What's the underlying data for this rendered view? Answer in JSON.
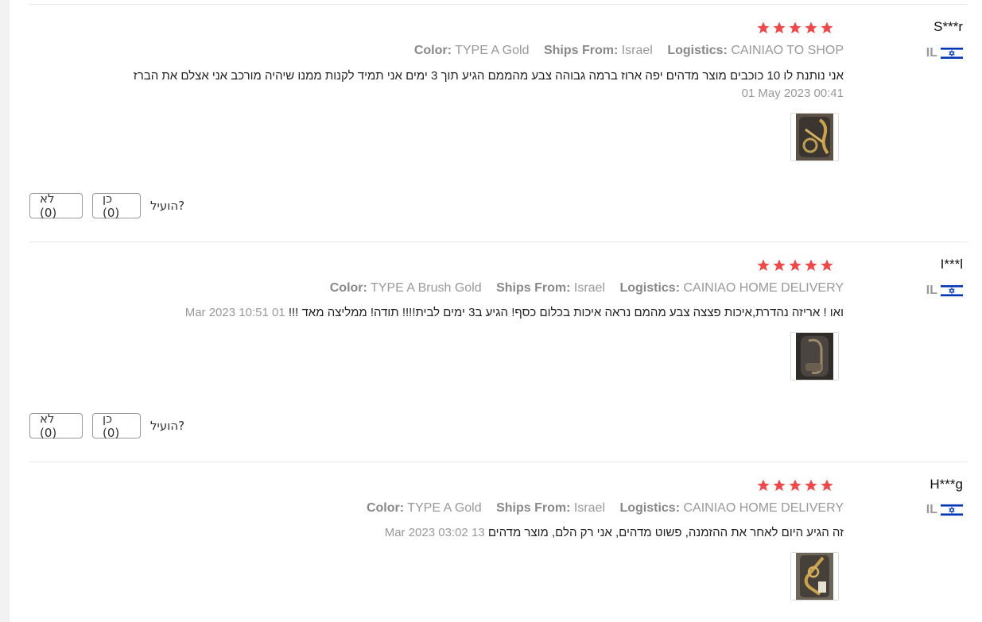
{
  "reviews": [
    {
      "user": "S***r",
      "country": "IL",
      "stars": 5,
      "color_label": "Color:",
      "color_value": "TYPE A Gold",
      "ships_label": "Ships From:",
      "ships_value": "Israel",
      "logistics_label": "Logistics:",
      "logistics_value": "CAINIAO TO SHOP",
      "text": "אני נותנת לו 10 כוכבים מוצר מדהים יפה ארוז ברמה גבוהה צבע מהממם הגיע תוך 3 ימים אני תמיד לקנות ממנו שיהיה מורכב אני אצלם את הברז",
      "date": "01 May 2023 00:41",
      "helpful_label": "הועיל?",
      "yes_label": "כן (0)",
      "no_label": "לא (0)"
    },
    {
      "user": "I***l",
      "country": "IL",
      "stars": 5,
      "color_label": "Color:",
      "color_value": "TYPE A Brush Gold",
      "ships_label": "Ships From:",
      "ships_value": "Israel",
      "logistics_label": "Logistics:",
      "logistics_value": "CAINIAO HOME DELIVERY",
      "text": "ואו ! אריזה נהדרת,איכות פצצה צבע מהמם נראה איכות בכלום כסף! הגיע ב3 ימים לבית!!!! תודה! ממליצה מאד !!!",
      "date": "01 Mar 2023 10:51",
      "helpful_label": "הועיל?",
      "yes_label": "כן (0)",
      "no_label": "לא (0)"
    },
    {
      "user": "H***g",
      "country": "IL",
      "stars": 5,
      "color_label": "Color:",
      "color_value": "TYPE A Gold",
      "ships_label": "Ships From:",
      "ships_value": "Israel",
      "logistics_label": "Logistics:",
      "logistics_value": "CAINIAO HOME DELIVERY",
      "text": "זה הגיע היום לאחר את ההזמנה, פשוט מדהים, אני רק הלם, מוצר מדהים",
      "date": "13 Mar 2023 03:02"
    }
  ],
  "colors": {
    "star": "#f04848",
    "flag_blue": "#0038b8",
    "meta_gray": "#999999",
    "divider": "#e8e8e8"
  },
  "icons": [
    "star-icon",
    "israel-flag-icon",
    "review-photo"
  ]
}
